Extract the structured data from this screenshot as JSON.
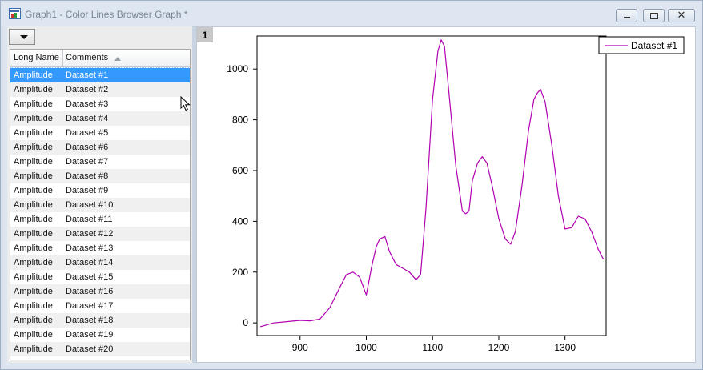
{
  "window": {
    "title": "Graph1 - Color Lines Browser Graph *",
    "close_glyph": "✕"
  },
  "browser": {
    "columns": {
      "long_name": "Long Name",
      "comments": "Comments"
    },
    "rows": [
      {
        "long_name": "Amplitude",
        "comment": "Dataset #1"
      },
      {
        "long_name": "Amplitude",
        "comment": "Dataset #2"
      },
      {
        "long_name": "Amplitude",
        "comment": "Dataset #3"
      },
      {
        "long_name": "Amplitude",
        "comment": "Dataset #4"
      },
      {
        "long_name": "Amplitude",
        "comment": "Dataset #5"
      },
      {
        "long_name": "Amplitude",
        "comment": "Dataset #6"
      },
      {
        "long_name": "Amplitude",
        "comment": "Dataset #7"
      },
      {
        "long_name": "Amplitude",
        "comment": "Dataset #8"
      },
      {
        "long_name": "Amplitude",
        "comment": "Dataset #9"
      },
      {
        "long_name": "Amplitude",
        "comment": "Dataset #10"
      },
      {
        "long_name": "Amplitude",
        "comment": "Dataset #11"
      },
      {
        "long_name": "Amplitude",
        "comment": "Dataset #12"
      },
      {
        "long_name": "Amplitude",
        "comment": "Dataset #13"
      },
      {
        "long_name": "Amplitude",
        "comment": "Dataset #14"
      },
      {
        "long_name": "Amplitude",
        "comment": "Dataset #15"
      },
      {
        "long_name": "Amplitude",
        "comment": "Dataset #16"
      },
      {
        "long_name": "Amplitude",
        "comment": "Dataset #17"
      },
      {
        "long_name": "Amplitude",
        "comment": "Dataset #18"
      },
      {
        "long_name": "Amplitude",
        "comment": "Dataset #19"
      },
      {
        "long_name": "Amplitude",
        "comment": "Dataset #20"
      }
    ],
    "selected_index": 0
  },
  "graph": {
    "layer_label": "1"
  },
  "colors": {
    "series": "#b000b0",
    "selection": "#3399ff"
  },
  "chart_data": {
    "type": "line",
    "title": "",
    "xlabel": "",
    "ylabel": "",
    "xlim": [
      835,
      1362
    ],
    "ylim": [
      -50,
      1130
    ],
    "xticks": [
      900,
      1000,
      1100,
      1200,
      1300
    ],
    "yticks": [
      0,
      200,
      400,
      600,
      800,
      1000
    ],
    "grid": false,
    "legend": "top-right",
    "series": [
      {
        "name": "Dataset #1",
        "x": [
          840,
          860,
          880,
          900,
          915,
          930,
          945,
          960,
          970,
          980,
          990,
          1000,
          1008,
          1015,
          1020,
          1028,
          1035,
          1045,
          1055,
          1065,
          1075,
          1082,
          1090,
          1100,
          1108,
          1113,
          1118,
          1125,
          1135,
          1145,
          1150,
          1155,
          1160,
          1168,
          1175,
          1182,
          1190,
          1200,
          1210,
          1218,
          1225,
          1235,
          1245,
          1253,
          1258,
          1263,
          1270,
          1280,
          1290,
          1300,
          1310,
          1320,
          1330,
          1340,
          1350,
          1358
        ],
        "y": [
          -15,
          0,
          5,
          10,
          8,
          15,
          60,
          140,
          190,
          200,
          180,
          110,
          220,
          300,
          330,
          340,
          280,
          230,
          215,
          200,
          170,
          190,
          450,
          880,
          1070,
          1115,
          1090,
          900,
          620,
          440,
          430,
          440,
          560,
          630,
          655,
          630,
          540,
          410,
          330,
          310,
          360,
          540,
          760,
          880,
          905,
          920,
          870,
          700,
          500,
          370,
          375,
          420,
          410,
          360,
          290,
          250
        ]
      }
    ]
  }
}
